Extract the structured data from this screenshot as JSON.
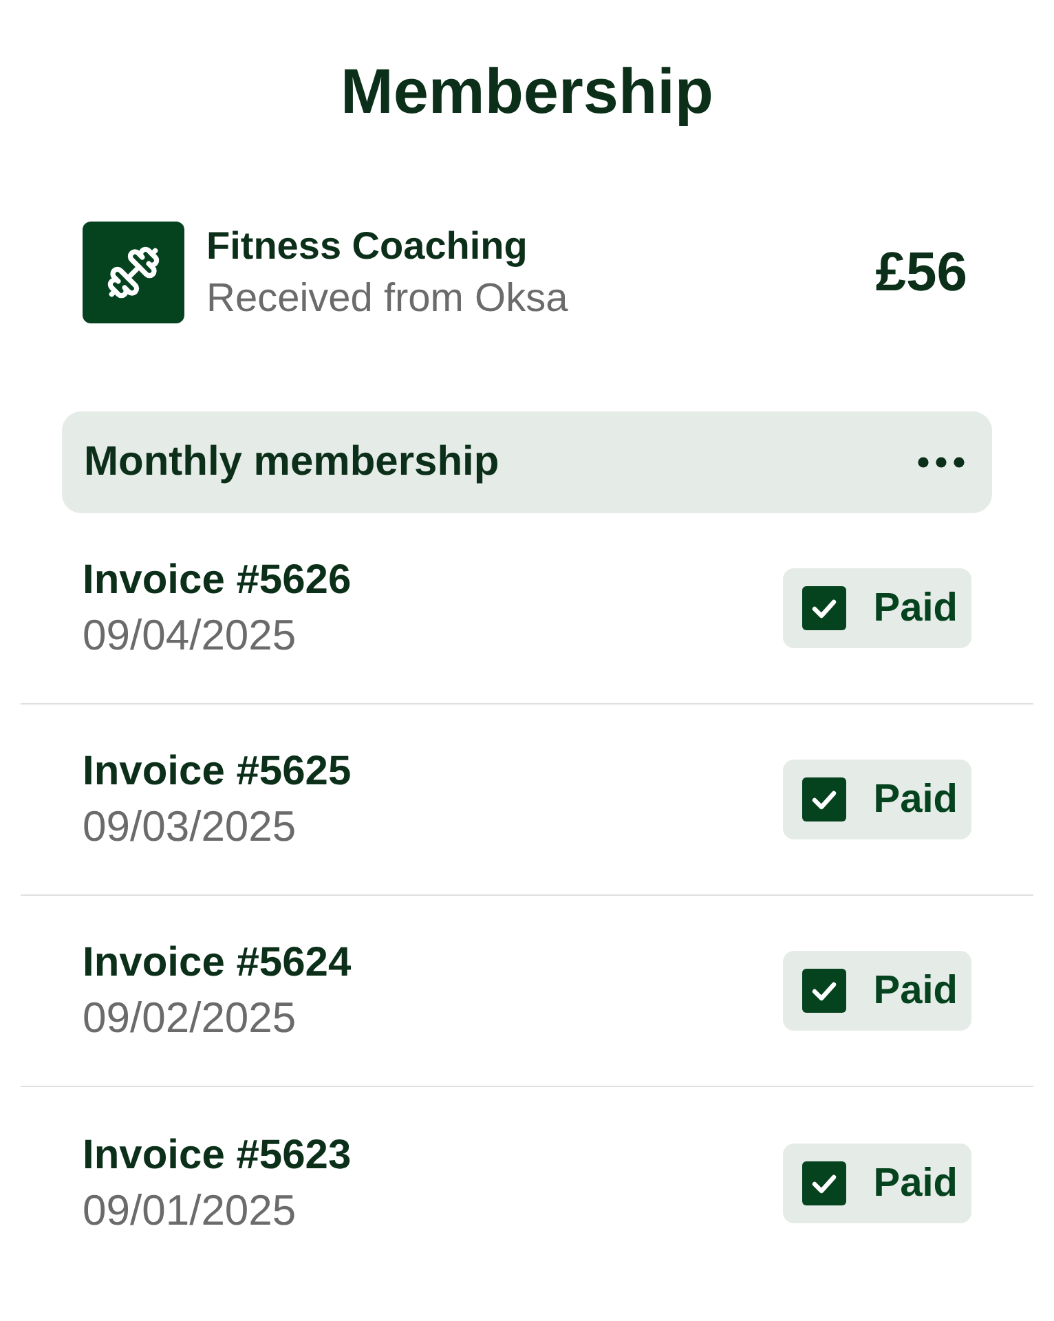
{
  "title": "Membership",
  "service": {
    "name": "Fitness Coaching",
    "subtitle": "Received from Oksa",
    "amount": "£56"
  },
  "group": {
    "title": "Monthly membership"
  },
  "invoices": [
    {
      "title": "Invoice #5626",
      "date": "09/04/2025",
      "status": "Paid",
      "checked": true
    },
    {
      "title": "Invoice #5625",
      "date": "09/03/2025",
      "status": "Paid",
      "checked": true
    },
    {
      "title": "Invoice #5624",
      "date": "09/02/2025",
      "status": "Paid",
      "checked": true
    },
    {
      "title": "Invoice #5623",
      "date": "09/01/2025",
      "status": "Paid",
      "checked": true
    }
  ]
}
